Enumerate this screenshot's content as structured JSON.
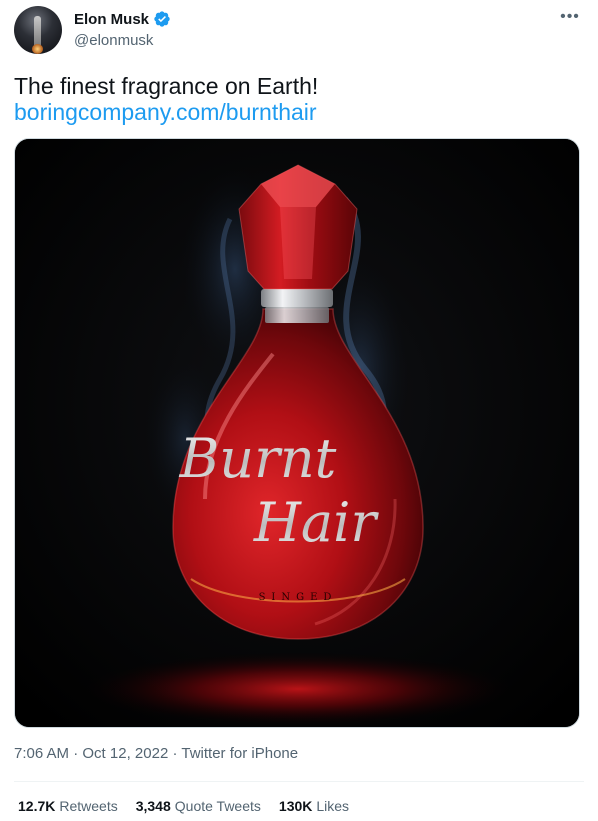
{
  "author": {
    "display_name": "Elon Musk",
    "handle": "@elonmusk",
    "verified": true
  },
  "tweet": {
    "text": "The finest fragrance on Earth!",
    "link": "boringcompany.com/burnthair"
  },
  "media": {
    "label_line1": "Burnt",
    "label_line2": "Hair",
    "label_brand": "SINGED"
  },
  "meta": {
    "time": "7:06 AM",
    "date": "Oct 12, 2022",
    "source": "Twitter for iPhone",
    "separator": "·"
  },
  "stats": {
    "retweets_count": "12.7K",
    "retweets_label": "Retweets",
    "quotes_count": "3,348",
    "quotes_label": "Quote Tweets",
    "likes_count": "130K",
    "likes_label": "Likes"
  },
  "colors": {
    "link": "#1d9bf0",
    "verified": "#1d9bf0",
    "secondary_text": "#536471",
    "bottle_red": "#c8141c"
  },
  "icons": {
    "verified": "verified-badge-icon",
    "more": "more-options-icon"
  }
}
